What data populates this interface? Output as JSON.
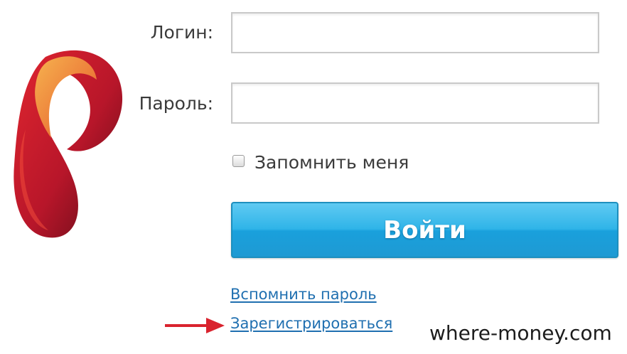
{
  "form": {
    "login_label": "Логин:",
    "login_value": "",
    "password_label": "Пароль:",
    "password_value": "",
    "remember_label": "Запомнить меня",
    "remember_checked": false,
    "submit_label": "Войти",
    "forgot_link": "Вспомнить пароль",
    "register_link": "Зарегистрироваться"
  },
  "brand": {
    "logo_icon": "rostelecom-logo",
    "logo_colors": [
      "#c8102e",
      "#7a0f1c",
      "#f08a24",
      "#f5b85a"
    ]
  },
  "annotation": {
    "arrow_icon": "red-arrow-right-icon",
    "arrow_color": "#d9232e"
  },
  "watermark": {
    "text": "where-money.com"
  },
  "colors": {
    "button": "#2fb4e8",
    "link": "#1f6fb0",
    "label": "#3a3a3a"
  }
}
